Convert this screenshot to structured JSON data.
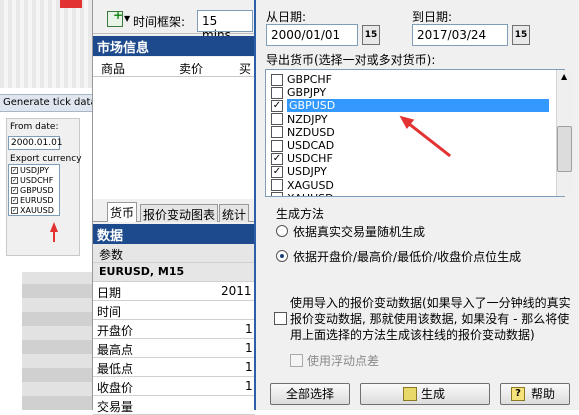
{
  "left_panel": {
    "title": "Generate tick data",
    "from_date_label": "From date:",
    "from_date_value": "2000.01.01",
    "export_label": "Export currency",
    "currencies": [
      "USDJPY",
      "USDCHF",
      "GBPUSD",
      "EURUSD",
      "XAUUSD"
    ]
  },
  "toolbar": {
    "timeframe_label": "时间框架:",
    "timeframe_value": "15 mins"
  },
  "market": {
    "title": "市场信息",
    "col_product": "商品",
    "col_sell": "卖价",
    "col_buy": "买"
  },
  "tabs": [
    "货币",
    "报价变动图表",
    "统计"
  ],
  "data": {
    "title": "数据",
    "col_param": "参数",
    "symbol": "EURUSD, M15",
    "rows": [
      {
        "label": "日期",
        "value": "2011"
      },
      {
        "label": "时间",
        "value": ""
      },
      {
        "label": "开盘价",
        "value": "1"
      },
      {
        "label": "最高点",
        "value": "1"
      },
      {
        "label": "最低点",
        "value": "1"
      },
      {
        "label": "收盘价",
        "value": "1"
      },
      {
        "label": "交易量",
        "value": ""
      }
    ]
  },
  "dialog": {
    "from_label": "从日期:",
    "from_value": "2000/01/01",
    "to_label": "到日期:",
    "to_value": "2017/03/24",
    "cal_text": "15",
    "currency_label": "导出货币(选择一对或多对货币):",
    "currency_list": [
      {
        "name": "GBPCHF",
        "checked": false,
        "selected": false
      },
      {
        "name": "GBPJPY",
        "checked": false,
        "selected": false
      },
      {
        "name": "GBPUSD",
        "checked": true,
        "selected": true
      },
      {
        "name": "NZDJPY",
        "checked": false,
        "selected": false
      },
      {
        "name": "NZDUSD",
        "checked": false,
        "selected": false
      },
      {
        "name": "USDCAD",
        "checked": false,
        "selected": false
      },
      {
        "name": "USDCHF",
        "checked": true,
        "selected": false
      },
      {
        "name": "USDJPY",
        "checked": true,
        "selected": false
      },
      {
        "name": "XAGUSD",
        "checked": false,
        "selected": false
      },
      {
        "name": "XAUUSD",
        "checked": false,
        "selected": false
      }
    ],
    "gen_method_label": "生成方法",
    "radio1": "依据真实交易量随机生成",
    "radio2": "依据开盘价/最高价/最低价/收盘价点位生成",
    "import_text": "使用导入的报价变动数据(如果导入了一分钟线的真实报价变动数据, 那就使用该数据, 如果没有 - 那么将使用上面选择的方法生成该柱线的报价变动数据)",
    "floating_spread": "使用浮动点差",
    "btn_select_all": "全部选择",
    "btn_generate": "生成",
    "btn_help": "帮助"
  }
}
